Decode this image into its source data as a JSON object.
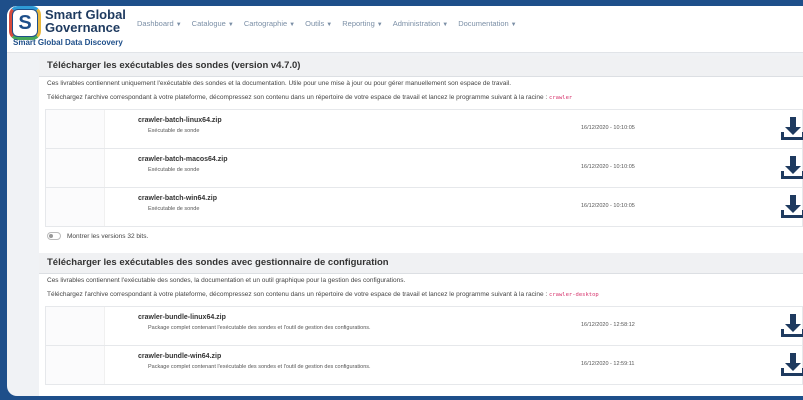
{
  "header": {
    "logo_letter": "S",
    "brand_line1": "Smart Global",
    "brand_line2": "Governance",
    "tagline": "Smart Global Data Discovery"
  },
  "nav": {
    "items": [
      {
        "label": "Dashboard"
      },
      {
        "label": "Catalogue"
      },
      {
        "label": "Cartographie"
      },
      {
        "label": "Outils"
      },
      {
        "label": "Reporting"
      },
      {
        "label": "Administration"
      },
      {
        "label": "Documentation"
      }
    ]
  },
  "section1": {
    "title": "Télécharger les exécutables des sondes (version v4.7.0)",
    "desc1": "Ces livrables contiennent uniquement l'exécutable des sondes et la documentation. Utile pour une mise à jour ou pour gérer manuellement son espace de travail.",
    "desc2": "Téléchargez l'archive correspondant à votre plateforme, décompressez son contenu dans un répertoire de votre espace de travail et lancez le programme suivant à la racine :",
    "command": "crawler",
    "files": [
      {
        "name": "crawler-batch-linux64.zip",
        "desc": "Exécutable de sonde",
        "date": "16/12/2020 - 10:10:05"
      },
      {
        "name": "crawler-batch-macos64.zip",
        "desc": "Exécutable de sonde",
        "date": "16/12/2020 - 10:10:05"
      },
      {
        "name": "crawler-batch-win64.zip",
        "desc": "Exécutable de sonde",
        "date": "16/12/2020 - 10:10:05"
      }
    ],
    "toggle_label": "Montrer les versions 32 bits."
  },
  "section2": {
    "title": "Télécharger les exécutables des sondes avec gestionnaire de configuration",
    "desc1": "Ces livrables contiennent l'exécutable des sondes, la documentation et un outil graphique pour la gestion des configurations.",
    "desc2": "Téléchargez l'archive correspondant à votre plateforme, décompressez son contenu dans un répertoire de votre espace de travail et lancez le programme suivant à la racine :",
    "command": "crawler-desktop",
    "files": [
      {
        "name": "crawler-bundle-linux64.zip",
        "desc": "Package complet contenant l'exécutable des sondes et l'outil de gestion des configurations.",
        "date": "16/12/2020 - 12:58:12"
      },
      {
        "name": "crawler-bundle-win64.zip",
        "desc": "Package complet contenant l'exécutable des sondes et l'outil de gestion des configurations.",
        "date": "16/12/2020 - 12:59:11"
      }
    ]
  },
  "colors": {
    "accent": "#1e4f8a",
    "download_icon": "#1e3a5f",
    "code": "#d6336c"
  },
  "icons": {
    "download": "download-icon",
    "caret": "chevron-down-icon"
  }
}
